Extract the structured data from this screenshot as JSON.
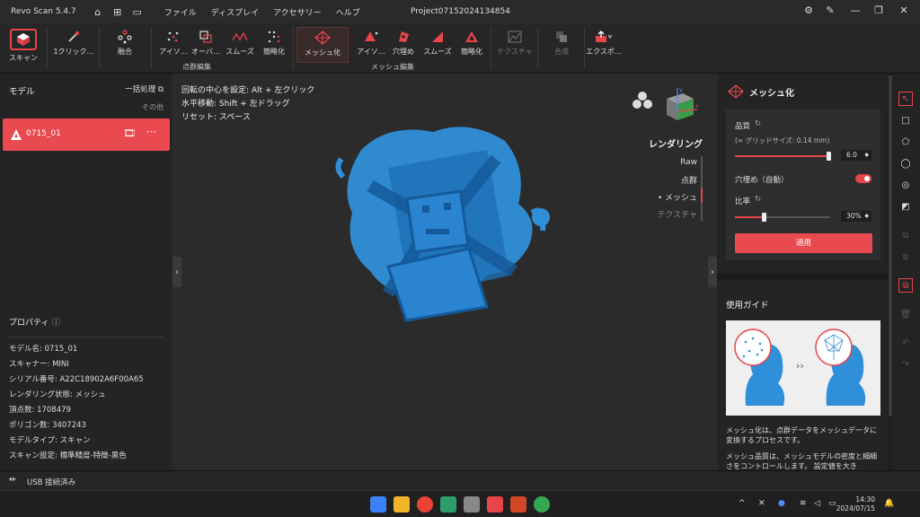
{
  "app": {
    "title": "Revo Scan 5.4.7",
    "project": "Project07152024134854"
  },
  "menu": [
    "ファイル",
    "ディスプレイ",
    "アクセサリー",
    "ヘルプ"
  ],
  "toolbar": {
    "scan": "スキャン",
    "one_click": "1クリック…",
    "fuse": "融合",
    "pc_iso": "アイソ…",
    "pc_over": "オーバ…",
    "pc_smooth": "スムーズ",
    "pc_simplify": "簡略化",
    "mesh": "メッシュ化",
    "m_iso": "アイソ…",
    "m_fill": "穴埋め",
    "m_smooth": "スムーズ",
    "m_simplify": "簡略化",
    "texture": "テクスチャ",
    "merge": "合成",
    "export": "エクスポ…",
    "group_pointcloud": "点群編集",
    "group_mesh": "メッシュ編集"
  },
  "left": {
    "header": "モデル",
    "batch": "一括処理",
    "other": "その他",
    "model_name": "0715_01",
    "props_header": "プロパティ",
    "props": [
      "モデル名:  0715_01",
      "スキャナー:  MINI",
      "シリアル番号:  A22C18902A6F00A65",
      "レンダリング状態:  メッシュ",
      "頂点数:  1708479",
      "ポリゴン数:  3407243",
      "モデルタイプ:  スキャン",
      "スキャン設定:  標準精度-特徴-黒色"
    ]
  },
  "viewport": {
    "hints": [
      "回転の中心を設定: Alt + 左クリック",
      "水平移動: Shift + 左ドラッグ",
      "リセット: スペース"
    ],
    "render_title": "レンダリング",
    "render_items": [
      "Raw",
      "点群",
      "• メッシュ",
      "テクスチャ"
    ]
  },
  "right": {
    "title": "メッシュ化",
    "quality_label": "品質",
    "grid_size": "(≈ グリッドサイズ: 0.14 mm)",
    "quality_value": "6.0",
    "quality_fraction": 0.98,
    "hole_fill": "穴埋め（自動）",
    "ratio_label": "比率",
    "ratio_value": "30%",
    "ratio_fraction": 0.3,
    "apply": "適用",
    "guide_header": "使用ガイド",
    "guide_text1": "メッシュ化は、点群データをメッシュデータに変換するプロセスです。",
    "guide_text2": "メッシュ品質は、メッシュモデルの密度と細細さをコントロールします。 設定値を大き"
  },
  "status": {
    "usb": "USB 接続済み"
  },
  "taskbar": {
    "time": "14:30",
    "date": "2024/07/15"
  },
  "colors": {
    "accent": "#e8454a",
    "model": "#2f8fd8"
  }
}
